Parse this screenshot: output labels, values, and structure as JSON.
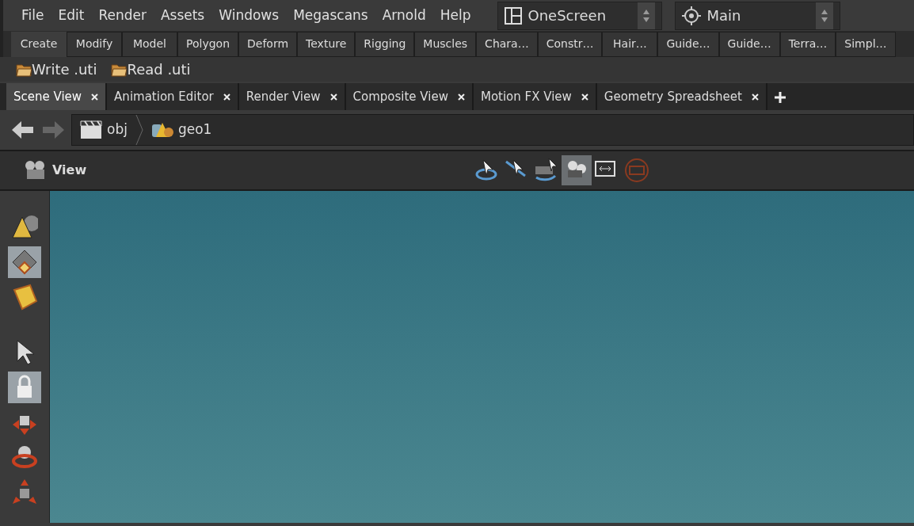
{
  "menu_bar": {
    "items": [
      "File",
      "Edit",
      "Render",
      "Assets",
      "Windows",
      "Megascans",
      "Arnold",
      "Help"
    ],
    "desktop": "OneScreen",
    "viewport_layout": "Main"
  },
  "shelf_tabs": [
    {
      "label": "Create",
      "selected": true
    },
    {
      "label": "Modify",
      "selected": false
    },
    {
      "label": "Model",
      "selected": false
    },
    {
      "label": "Polygon",
      "selected": false
    },
    {
      "label": "Deform",
      "selected": false
    },
    {
      "label": "Texture",
      "selected": false
    },
    {
      "label": "Rigging",
      "selected": false
    },
    {
      "label": "Muscles",
      "selected": false
    },
    {
      "label": "Chara…",
      "selected": false
    },
    {
      "label": "Constr…",
      "selected": false
    },
    {
      "label": "Hair…",
      "selected": false
    },
    {
      "label": "Guide…",
      "selected": false
    },
    {
      "label": "Guide…",
      "selected": false
    },
    {
      "label": "Terra…",
      "selected": false
    },
    {
      "label": "Simpl…",
      "selected": false
    }
  ],
  "shelf_tools": [
    "Write .uti",
    "Read .uti"
  ],
  "pane_tabs": [
    {
      "label": "Scene View",
      "selected": true
    },
    {
      "label": "Animation Editor",
      "selected": false
    },
    {
      "label": "Render View",
      "selected": false
    },
    {
      "label": "Composite View",
      "selected": false
    },
    {
      "label": "Motion FX View",
      "selected": false
    },
    {
      "label": "Geometry Spreadsheet",
      "selected": false
    }
  ],
  "path": [
    {
      "label": "obj",
      "kind": "network"
    },
    {
      "label": "geo1",
      "kind": "geometry"
    }
  ],
  "viewer": {
    "title": "View",
    "tools": [
      {
        "kind": "tumble",
        "selected": false
      },
      {
        "kind": "track",
        "selected": false
      },
      {
        "kind": "dolly",
        "selected": false
      },
      {
        "kind": "camera",
        "selected": true
      },
      {
        "kind": "frame",
        "selected": false
      },
      {
        "kind": "stop",
        "selected": false
      }
    ]
  },
  "left_toolbar": [
    {
      "kind": "object-mode",
      "selected": false
    },
    {
      "kind": "component-mode",
      "selected": true
    },
    {
      "kind": "dynamics-mode",
      "selected": false
    },
    {
      "kind": "select",
      "selected": false
    },
    {
      "kind": "lock",
      "selected": true
    },
    {
      "kind": "move",
      "selected": false
    },
    {
      "kind": "rotate",
      "selected": false
    },
    {
      "kind": "scale",
      "selected": false
    }
  ]
}
